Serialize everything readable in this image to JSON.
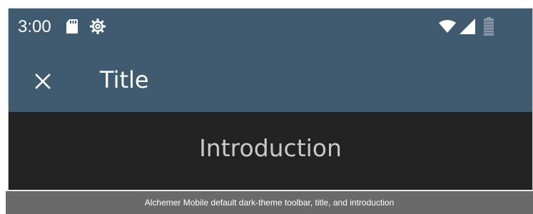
{
  "status_bar": {
    "time": "3:00",
    "icons": [
      "sd-card-icon",
      "settings-icon",
      "wifi-icon",
      "signal-icon",
      "battery-icon"
    ]
  },
  "toolbar": {
    "close_icon": "close-icon",
    "title": "Title"
  },
  "content": {
    "heading": "Introduction"
  },
  "caption": "Alchemer Mobile default dark-theme toolbar, title, and introduction",
  "colors": {
    "toolbar_bg": "#405a70",
    "content_bg": "#222222",
    "heading_text": "#c9c9c9",
    "caption_bg": "#6a6a6a"
  }
}
